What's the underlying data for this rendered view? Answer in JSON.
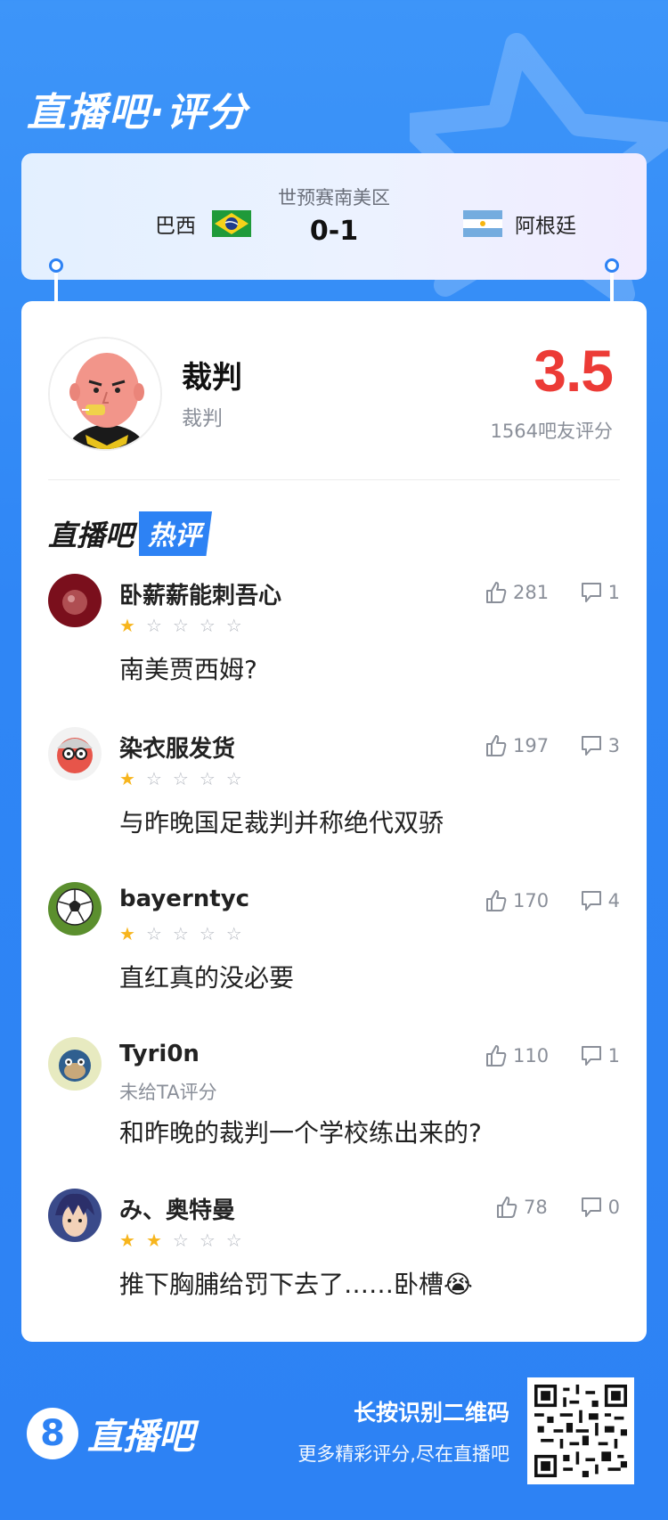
{
  "header": {
    "title": "直播吧·评分"
  },
  "match": {
    "home_team": "巴西",
    "away_team": "阿根廷",
    "competition": "世预赛南美区",
    "score": "0-1"
  },
  "person": {
    "name": "裁判",
    "role": "裁判",
    "rating": "3.5",
    "rating_count": "1564吧友评分"
  },
  "hot_section": {
    "title_a": "直播吧",
    "title_b": "热评"
  },
  "comments": [
    {
      "user": "卧薪薪能刺吾心",
      "stars": 1,
      "text": "南美贾西姆?",
      "likes": "281",
      "replies": "1",
      "unrated": ""
    },
    {
      "user": "染衣服发货",
      "stars": 1,
      "text": "与昨晚国足裁判并称绝代双骄",
      "likes": "197",
      "replies": "3",
      "unrated": ""
    },
    {
      "user": "bayerntyc",
      "stars": 1,
      "text": "直红真的没必要",
      "likes": "170",
      "replies": "4",
      "unrated": ""
    },
    {
      "user": "Tyri0n",
      "stars": 0,
      "text": "和昨晚的裁判一个学校练出来的?",
      "likes": "110",
      "replies": "1",
      "unrated": "未给TA评分"
    },
    {
      "user": "み、奥特曼",
      "stars": 2,
      "text": "推下胸脯给罚下去了……卧槽😭",
      "likes": "78",
      "replies": "0",
      "unrated": ""
    }
  ],
  "footer": {
    "logo_number": "8",
    "logo_text": "直播吧",
    "cta_line1": "长按识别二维码",
    "cta_line2": "更多精彩评分,尽在直播吧"
  },
  "colors": {
    "brand_blue": "#2d82f4",
    "rating_red": "#ec3b36",
    "star_on": "#f7b51d"
  }
}
